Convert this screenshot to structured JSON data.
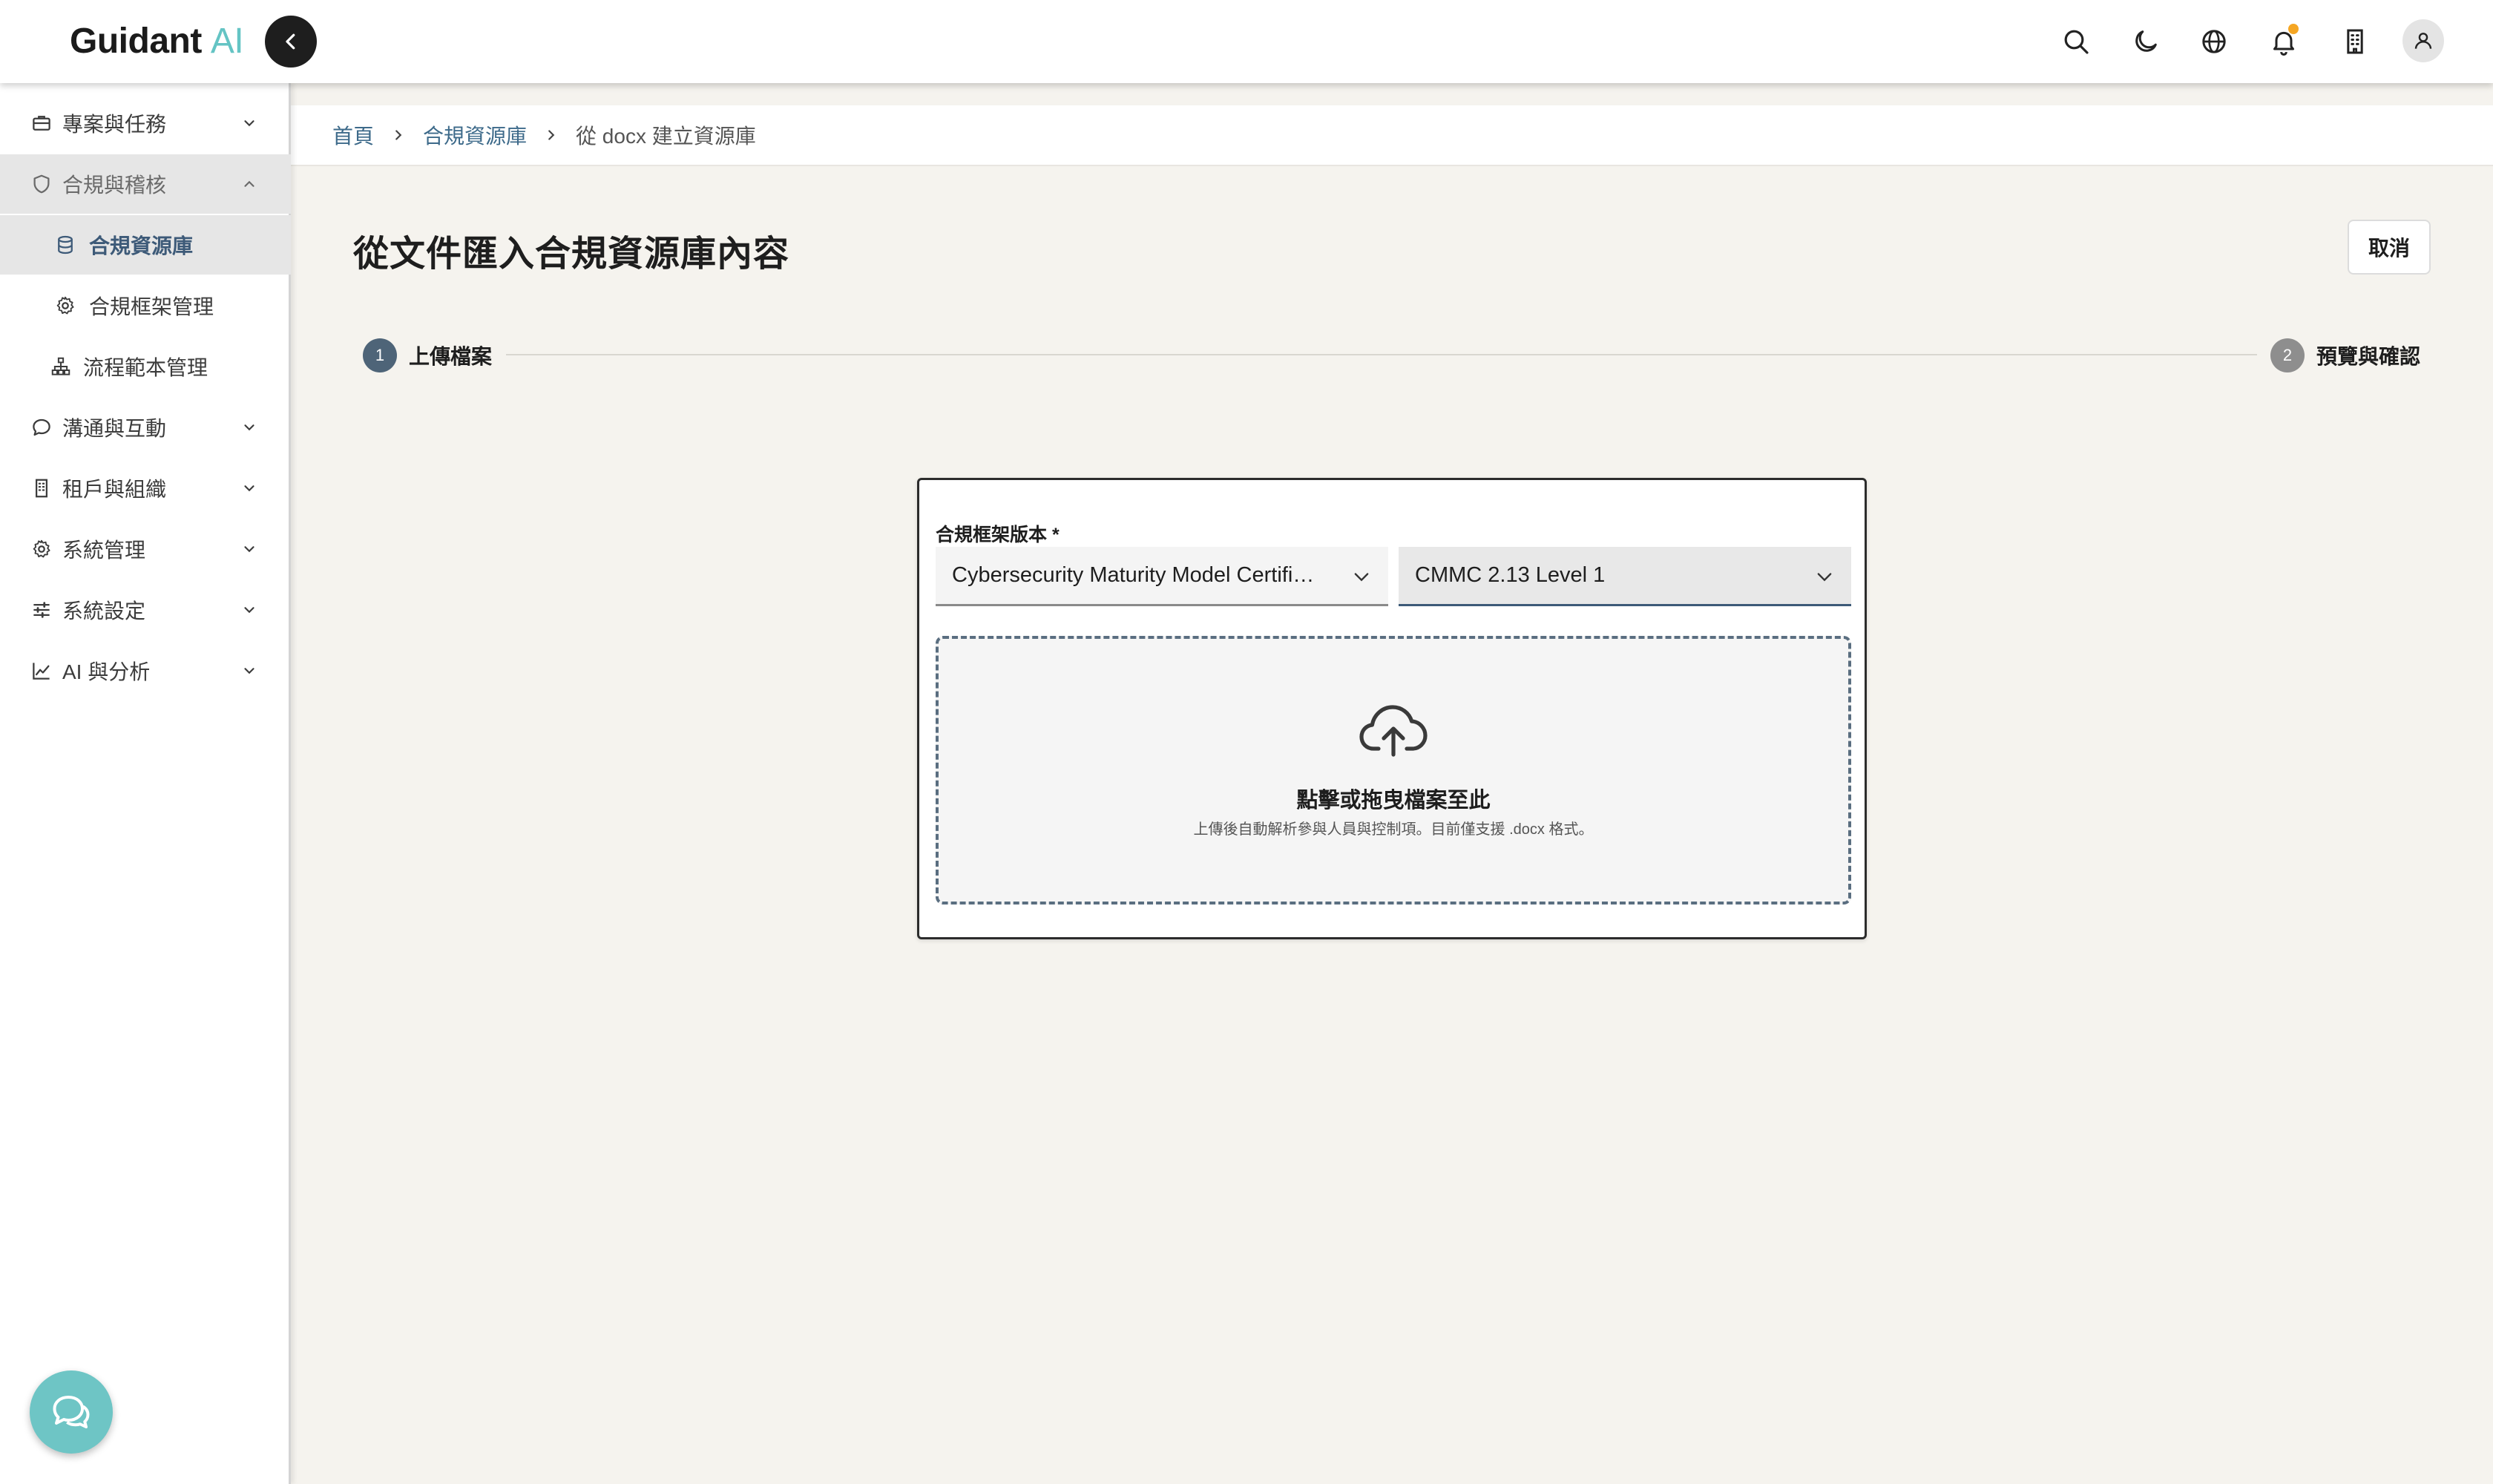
{
  "header": {
    "brand_name": "Guidant",
    "brand_suffix": "AI",
    "icons": [
      "search-icon",
      "moon-icon",
      "globe-icon",
      "bell-icon",
      "building-icon",
      "user-icon"
    ]
  },
  "sidebar": {
    "items": [
      {
        "label": "專案與任務",
        "icon": "briefcase-icon"
      },
      {
        "label": "合規與稽核",
        "icon": "shield-icon"
      },
      {
        "label": "合規資源庫",
        "icon": "database-icon"
      },
      {
        "label": "合規框架管理",
        "icon": "gear-icon"
      },
      {
        "label": "流程範本管理",
        "icon": "sitemap-icon"
      },
      {
        "label": "溝通與互動",
        "icon": "chat-icon"
      },
      {
        "label": "租戶與組織",
        "icon": "building-icon"
      },
      {
        "label": "系統管理",
        "icon": "gear-icon"
      },
      {
        "label": "系統設定",
        "icon": "sliders-icon"
      },
      {
        "label": "AI 與分析",
        "icon": "chart-icon"
      }
    ]
  },
  "breadcrumb": {
    "home": "首頁",
    "library": "合規資源庫",
    "current": "從 docx 建立資源庫"
  },
  "page": {
    "title": "從文件匯入合規資源庫內容",
    "cancel_label": "取消"
  },
  "stepper": {
    "steps": [
      {
        "number": "1",
        "label": "上傳檔案",
        "state": "active"
      },
      {
        "number": "2",
        "label": "預覽與確認",
        "state": "pending"
      }
    ]
  },
  "form": {
    "framework_label": "合規框架版本 *",
    "framework_value": "Cybersecurity Maturity Model Certifica...",
    "version_value": "CMMC 2.13 Level 1",
    "drop_title": "點擊或拖曳檔案至此",
    "drop_hint": "上傳後自動解析參與人員與控制項。目前僅支援 .docx 格式。"
  },
  "colors": {
    "accent": "#3d5a78",
    "brand_ai": "#64c4c4",
    "notification": "#f5a623",
    "step_active": "#4e6478",
    "step_pending": "#8e8e8e"
  }
}
